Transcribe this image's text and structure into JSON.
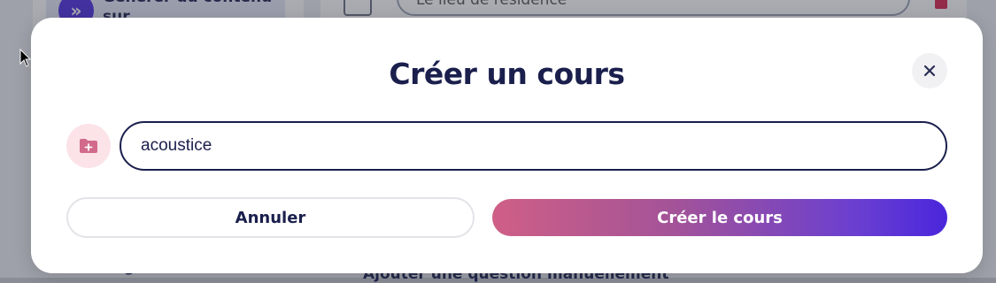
{
  "background": {
    "sidebar_item_label": "Générer du contenu sur",
    "field_text": "Le lieu de résidence",
    "bottom_text_left": "g",
    "bottom_text_right": "Ajouter une question manuellement"
  },
  "modal": {
    "title": "Créer un cours",
    "input": {
      "value": "acoustice",
      "placeholder": ""
    },
    "cancel_label": "Annuler",
    "create_label": "Créer le cours",
    "icons": {
      "close": "close-icon",
      "folder": "folder-plus-icon"
    }
  },
  "colors": {
    "title": "#1a1f4c",
    "gradient_start": "#cf5f86",
    "gradient_end": "#4a26dc",
    "folder_badge_bg": "#fbe3e8",
    "folder_icon": "#d26a8b"
  }
}
